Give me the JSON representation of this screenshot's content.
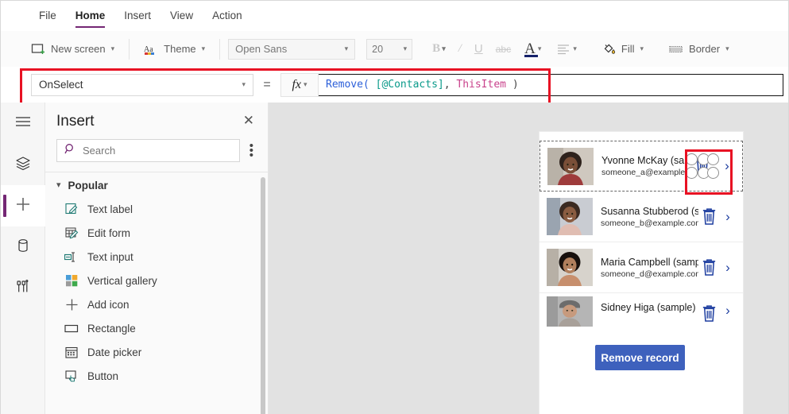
{
  "menubar": {
    "items": [
      {
        "label": "File",
        "active": false
      },
      {
        "label": "Home",
        "active": true
      },
      {
        "label": "Insert",
        "active": false
      },
      {
        "label": "View",
        "active": false
      },
      {
        "label": "Action",
        "active": false
      }
    ]
  },
  "ribbon": {
    "new_screen_label": "New screen",
    "theme_label": "Theme",
    "font_name": "Open Sans",
    "font_size": "20",
    "bold_label": "B",
    "italic_label": "I",
    "underline_label": "U",
    "strikethrough_label": "abc",
    "font_color_label": "A",
    "align_label": "align",
    "fill_label": "Fill",
    "border_label": "Border"
  },
  "formula_bar": {
    "property": "OnSelect",
    "equals": "=",
    "fx_label": "fx",
    "formula_tokens": [
      {
        "text": "Remove(",
        "kind": "fn"
      },
      {
        "text": " ",
        "kind": "p"
      },
      {
        "text": "[@Contacts]",
        "kind": "src"
      },
      {
        "text": ", ",
        "kind": "p"
      },
      {
        "text": "ThisItem",
        "kind": "kw"
      },
      {
        "text": " )",
        "kind": "p"
      }
    ],
    "formula_text": "Remove( [@Contacts], ThisItem )"
  },
  "rail": {
    "items": [
      {
        "name": "hamburger-menu-icon",
        "selected": false
      },
      {
        "name": "tree-view-icon",
        "selected": false
      },
      {
        "name": "insert-icon",
        "selected": true
      },
      {
        "name": "data-icon",
        "selected": false
      },
      {
        "name": "advanced-tools-icon",
        "selected": false
      }
    ]
  },
  "insert_panel": {
    "title": "Insert",
    "close_label": "✕",
    "search_placeholder": "Search",
    "group_label": "Popular",
    "items": [
      {
        "label": "Text label",
        "icon": "text-label-icon"
      },
      {
        "label": "Edit form",
        "icon": "edit-form-icon"
      },
      {
        "label": "Text input",
        "icon": "text-input-icon"
      },
      {
        "label": "Vertical gallery",
        "icon": "vertical-gallery-icon"
      },
      {
        "label": "Add icon",
        "icon": "add-icon"
      },
      {
        "label": "Rectangle",
        "icon": "rectangle-icon"
      },
      {
        "label": "Date picker",
        "icon": "date-picker-icon"
      },
      {
        "label": "Button",
        "icon": "button-icon"
      }
    ]
  },
  "canvas": {
    "gallery": {
      "rows": [
        {
          "name": "Yvonne McKay (sample)",
          "email": "someone_a@example.com",
          "selected": true,
          "photo_top": "#6f5a4e",
          "photo_bottom": "#c2a68e"
        },
        {
          "name": "Susanna Stubberod (sample)",
          "email": "someone_b@example.com",
          "selected": false,
          "photo_top": "#7e6253",
          "photo_bottom": "#d3b49d"
        },
        {
          "name": "Maria Campbell (sample)",
          "email": "someone_d@example.com",
          "selected": false,
          "photo_top": "#3a2c28",
          "photo_bottom": "#c9a891"
        },
        {
          "name": "Sidney Higa (sample)",
          "email": "",
          "selected": false,
          "photo_top": "#8d8d8d",
          "photo_bottom": "#b9a091"
        }
      ],
      "chevron": "›"
    },
    "remove_button_label": "Remove record"
  },
  "colors": {
    "accent_purple": "#742774",
    "highlight_red": "#e81123",
    "button_blue": "#3e61bd",
    "icon_blue": "#1f3fa0",
    "formula_fn": "#2b5fd9",
    "formula_source": "#0a9a8a",
    "formula_keyword": "#c9438c"
  }
}
